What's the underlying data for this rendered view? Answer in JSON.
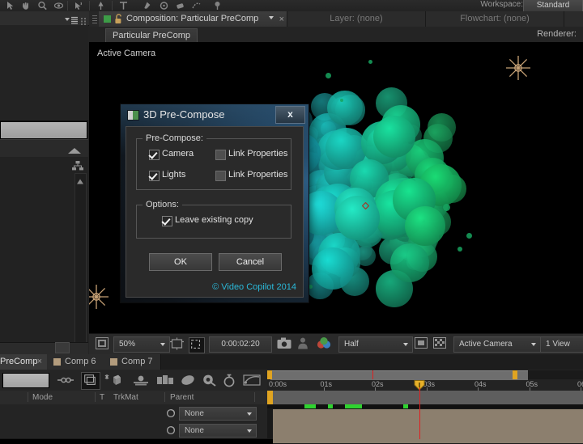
{
  "toolstrip": {
    "workspace_label": "Workspace:",
    "workspace_value": "Standard"
  },
  "viewer_tabs": {
    "composition_tab": "Composition: Particular PreComp",
    "layer_tab": "Layer: (none)",
    "flowchart_tab": "Flowchart: (none)",
    "close_glyph": "×"
  },
  "subtab": {
    "comp_name": "Particular PreComp",
    "renderer_label": "Renderer:"
  },
  "canvas": {
    "camera_label": "Active Camera"
  },
  "viewer_toolbar": {
    "zoom": "50%",
    "timecode": "0:00:02:20",
    "resolution": "Half",
    "view_camera": "Active Camera",
    "view_layout": "1 View"
  },
  "timeline_tabs": [
    {
      "label": "PreComp",
      "active": true,
      "closable": true,
      "swatch": false
    },
    {
      "label": "Comp 6",
      "active": false,
      "closable": false,
      "swatch": true
    },
    {
      "label": "Comp 7",
      "active": false,
      "closable": false,
      "swatch": true
    }
  ],
  "timeline_columns": [
    "Mode",
    "T",
    "TrkMat",
    "Parent"
  ],
  "timeline_rows": [
    {
      "parent": "None"
    },
    {
      "parent": "None"
    }
  ],
  "time_ruler": {
    "labels": [
      "0:00s",
      "01s",
      "02s",
      "03s",
      "04s",
      "05s",
      "06"
    ],
    "playhead_label": "03s"
  },
  "dialog": {
    "title": "3D Pre-Compose",
    "close_label": "x",
    "group_precompose": "Pre-Compose:",
    "group_options": "Options:",
    "checkboxes": [
      {
        "label": "Camera",
        "checked": true
      },
      {
        "label": "Link Properties",
        "checked": false
      },
      {
        "label": "Lights",
        "checked": true
      },
      {
        "label": "Link Properties",
        "checked": false
      }
    ],
    "leave_existing_copy": {
      "label": "Leave existing copy",
      "checked": true
    },
    "ok_label": "OK",
    "cancel_label": "Cancel",
    "copyright": "© Video Copilot 2014",
    "accent_color": "#2ab8d8"
  }
}
